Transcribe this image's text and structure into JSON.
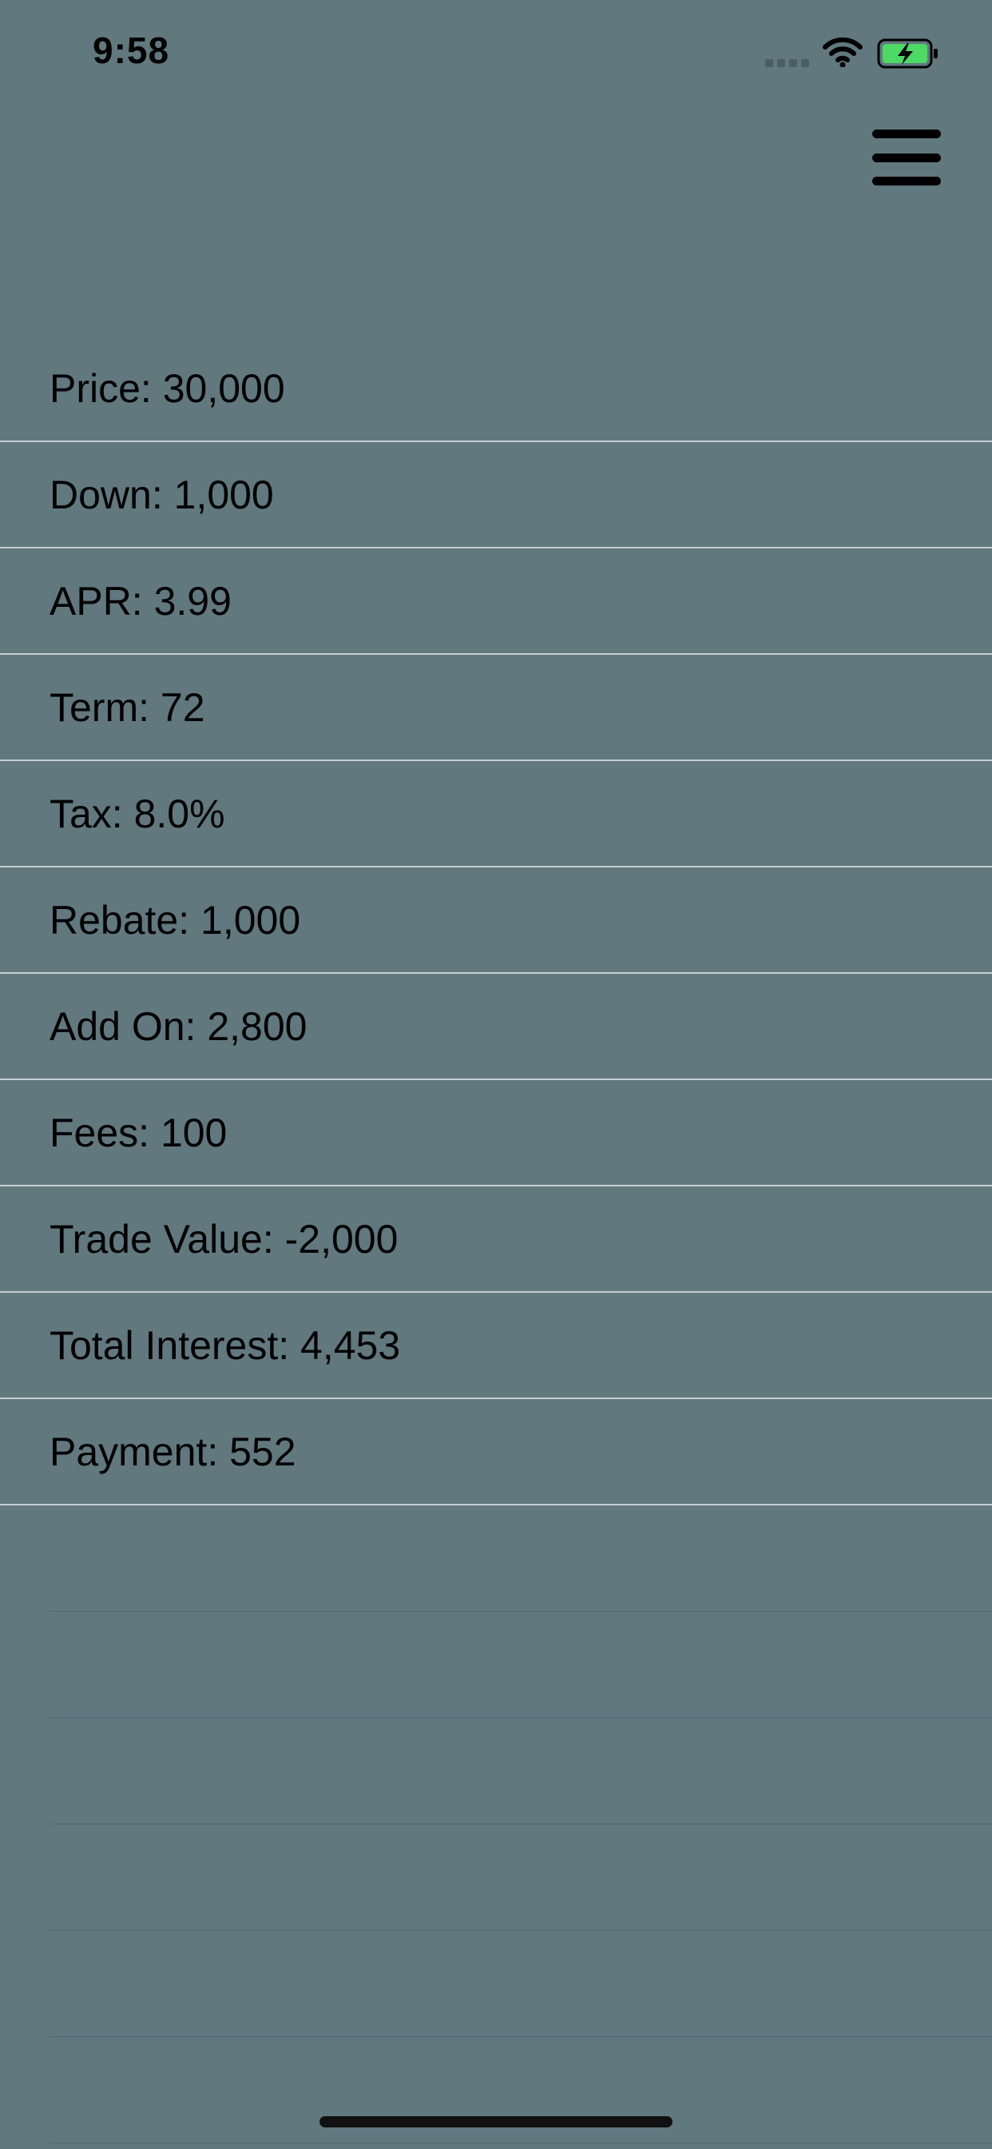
{
  "status_bar": {
    "time": "9:58",
    "icons": [
      "signal-icon",
      "wifi-icon",
      "battery-charging-icon"
    ],
    "battery_color": "#4cd964"
  },
  "header": {
    "menu_icon": "hamburger-menu-icon"
  },
  "rows": [
    {
      "label": "Price: 30,000"
    },
    {
      "label": "Down: 1,000"
    },
    {
      "label": "APR: 3.99"
    },
    {
      "label": "Term: 72"
    },
    {
      "label": "Tax: 8.0%"
    },
    {
      "label": "Rebate: 1,000"
    },
    {
      "label": "Add On: 2,800"
    },
    {
      "label": "Fees: 100"
    },
    {
      "label": "Trade Value: -2,000"
    },
    {
      "label": "Total Interest: 4,453"
    },
    {
      "label": "Payment: 552"
    }
  ],
  "colors": {
    "background": "#61787e",
    "separator": "#c4d0d3",
    "text": "#000000"
  }
}
